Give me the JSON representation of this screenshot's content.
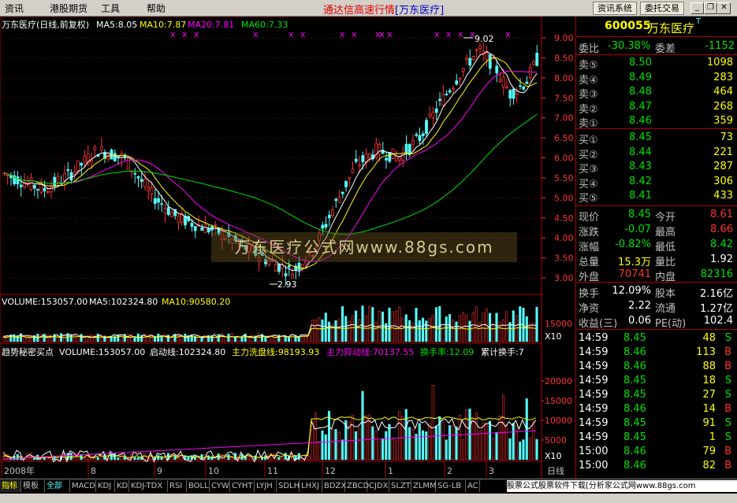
{
  "menu": {
    "items": [
      {
        "label": "资讯"
      },
      {
        "label": "港股期货"
      },
      {
        "label": "工具"
      },
      {
        "label": "帮助"
      }
    ],
    "title_main": "通达信高速行情",
    "title_stock": "[万东医疗]",
    "btn_info": "资讯系统",
    "btn_trade": "委托交易"
  },
  "main_chart": {
    "header_name": "万东医疗(日线,前复权)",
    "ma5": "MA5:8.05",
    "ma10": "MA10:7.87",
    "ma20": "MA20:7.81",
    "ma60": "MA60:7.33",
    "high_marker": "9.02",
    "low_marker": "2.93",
    "y_ticks": [
      "9.00",
      "8.50",
      "8.00",
      "7.50",
      "7.00",
      "6.50",
      "6.00",
      "5.50",
      "5.00",
      "4.50",
      "4.00",
      "3.50",
      "3.00"
    ],
    "watermark": "万东医疗公式网www.88gs.com"
  },
  "volume_chart": {
    "header_volume": "VOLUME:153057.00",
    "header_ma5": "MA5:102324.80",
    "header_ma10": "MA10:90580.20",
    "y_tick": "15000",
    "unit": "X10"
  },
  "indicator_chart": {
    "header_name": "趋势秘密买点",
    "header_volume": "VOLUME:153057.00",
    "header_start": "启动线:102324.80",
    "header_wash": "主力洗盘线:98193.93",
    "header_move": "主力异动线:70137.55",
    "header_turnover": "换手率:12.09",
    "header_cum": "累计换手:7",
    "y_ticks": [
      "20000",
      "15000",
      "10000",
      "5000"
    ],
    "unit": "X10",
    "x_labels": [
      "2008年",
      "8",
      "9",
      "10",
      "11",
      "12",
      "1",
      "2",
      "3"
    ]
  },
  "quote_panel": {
    "code": "600055",
    "name": "万东医疗",
    "wb_label": "委比",
    "wb_value": "-30.38%",
    "wc_label": "委差",
    "wc_value": "-1152",
    "asks": [
      {
        "label": "卖⑤",
        "price": "8.50",
        "vol": "1098"
      },
      {
        "label": "卖④",
        "price": "8.49",
        "vol": "283"
      },
      {
        "label": "卖③",
        "price": "8.48",
        "vol": "464"
      },
      {
        "label": "卖②",
        "price": "8.47",
        "vol": "268"
      },
      {
        "label": "卖①",
        "price": "8.46",
        "vol": "359"
      }
    ],
    "bids": [
      {
        "label": "买①",
        "price": "8.45",
        "vol": "73"
      },
      {
        "label": "买②",
        "price": "8.44",
        "vol": "221"
      },
      {
        "label": "买③",
        "price": "8.43",
        "vol": "287"
      },
      {
        "label": "买④",
        "price": "8.42",
        "vol": "306"
      },
      {
        "label": "买⑤",
        "price": "8.41",
        "vol": "433"
      }
    ],
    "stats": [
      {
        "l1": "现价",
        "v1": "8.45",
        "l2": "今开",
        "v2": "8.61"
      },
      {
        "l1": "涨跌",
        "v1": "-0.07",
        "l2": "最高",
        "v2": "8.66"
      },
      {
        "l1": "涨幅",
        "v1": "-0.82%",
        "l2": "最低",
        "v2": "8.42"
      },
      {
        "l1": "总量",
        "v1": "15.3万",
        "l2": "量比",
        "v2": "1.92"
      },
      {
        "l1": "外盘",
        "v1": "70741",
        "l2": "内盘",
        "v2": "82316"
      }
    ],
    "stats2": [
      {
        "l1": "换手",
        "v1": "12.09%",
        "l2": "股本",
        "v2": "2.16亿"
      },
      {
        "l1": "净资",
        "v1": "2.22",
        "l2": "流通",
        "v2": "1.27亿"
      },
      {
        "l1": "收益(三)",
        "v1": "0.06",
        "l2": "PE(动)",
        "v2": "102.4"
      }
    ],
    "ticks": [
      {
        "time": "14:59",
        "price": "8.45",
        "vol": "48",
        "side": "S"
      },
      {
        "time": "14:59",
        "price": "8.46",
        "vol": "113",
        "side": "B"
      },
      {
        "time": "14:59",
        "price": "8.46",
        "vol": "88",
        "side": "B"
      },
      {
        "time": "14:59",
        "price": "8.45",
        "vol": "18",
        "side": "S"
      },
      {
        "time": "14:59",
        "price": "8.45",
        "vol": "27",
        "side": "S"
      },
      {
        "time": "14:59",
        "price": "8.46",
        "vol": "14",
        "side": "B"
      },
      {
        "time": "14:59",
        "price": "8.45",
        "vol": "91",
        "side": "S"
      },
      {
        "time": "14:59",
        "price": "8.45",
        "vol": "1",
        "side": "S"
      },
      {
        "time": "15:00",
        "price": "8.46",
        "vol": "79",
        "side": "B"
      },
      {
        "time": "15:00",
        "price": "8.46",
        "vol": "82",
        "side": "B"
      }
    ]
  },
  "tabs": [
    "指标",
    "模板",
    "全部",
    "MACD",
    "KDJ",
    "KD",
    "KDJ-TDX",
    "RSI",
    "BOLL",
    "CYW",
    "CYHT",
    "LYJH",
    "SDLH",
    "LHXJ",
    "BDZX",
    "ZBCD",
    "CJDX",
    "SLZT",
    "ZLMM",
    "SG-LB",
    "AC"
  ],
  "promo": "股票公式股票软件下载[分析家公式网www.88gs.com",
  "period": "日线",
  "colors": {
    "up": "#ff3232",
    "down": "#54fcfc",
    "ma5": "#ffffff",
    "ma10": "#ffff00",
    "ma20": "#ff00ff",
    "ma60": "#00e000",
    "border": "#b00000"
  }
}
